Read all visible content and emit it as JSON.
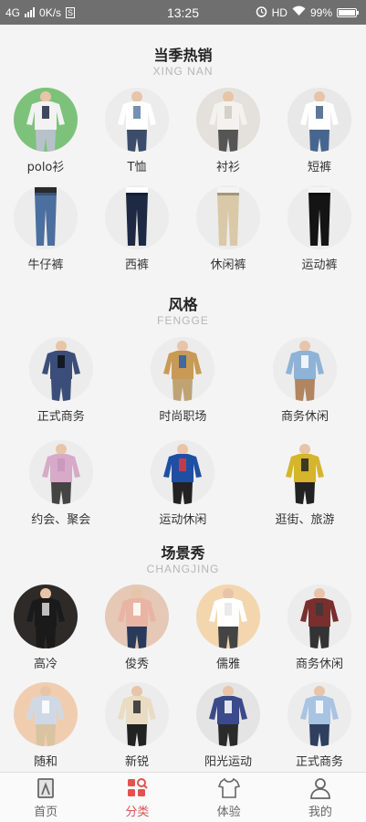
{
  "status_bar": {
    "network": "4G",
    "speed": "0K/s",
    "sim_badge": "S",
    "time": "13:25",
    "hd": "HD",
    "battery": "99%",
    "battery_level": 0.99
  },
  "sections": [
    {
      "title": "当季热销",
      "subtitle": "XING NAN",
      "items": [
        {
          "label": "polo衫",
          "icon": "polo-shirt",
          "bg": "#7dc27a",
          "top": "#f2f2f2",
          "accent": "#1f2a44",
          "bottom": "#b7c1cc"
        },
        {
          "label": "T恤",
          "icon": "t-shirt",
          "bg": "#ececec",
          "top": "#ffffff",
          "accent": "#5a7fa5",
          "bottom": "#3b4d6a"
        },
        {
          "label": "衬衫",
          "icon": "shirt",
          "bg": "#e4e1dc",
          "top": "#f4f2ee",
          "accent": "#cfcac3",
          "bottom": "#555555"
        },
        {
          "label": "短裤",
          "icon": "shorts",
          "bg": "#e8e8e8",
          "top": "#ffffff",
          "accent": "#3e5f8a",
          "bottom": "#46668f"
        },
        {
          "label": "牛仔裤",
          "icon": "jeans",
          "bg": "#ececec",
          "top": "#2a2a2a",
          "accent": "#4b6f9f",
          "bottom": "#4b6f9f"
        },
        {
          "label": "西裤",
          "icon": "trousers",
          "bg": "#ececec",
          "top": "#ffffff",
          "accent": "#1e2a44",
          "bottom": "#1e2a44"
        },
        {
          "label": "休闲裤",
          "icon": "chinos",
          "bg": "#ececec",
          "top": "#f4f4f4",
          "accent": "#d9c9a8",
          "bottom": "#d9c9a8"
        },
        {
          "label": "运动裤",
          "icon": "joggers",
          "bg": "#ececec",
          "top": "#f4f4f4",
          "accent": "#141414",
          "bottom": "#141414"
        }
      ]
    },
    {
      "title": "风格",
      "subtitle": "FENGGE",
      "items": [
        {
          "label": "正式商务",
          "icon": "suit",
          "bg": "#ececec",
          "top": "#3b4e7a",
          "accent": "#111111",
          "bottom": "#3b4e7a"
        },
        {
          "label": "时尚职场",
          "icon": "jacket",
          "bg": "#ececec",
          "top": "#c89a55",
          "accent": "#2b5fa8",
          "bottom": "#bfa374"
        },
        {
          "label": "商务休闲",
          "icon": "striped-shirt",
          "bg": "#ececec",
          "top": "#8fb3d6",
          "accent": "#ffffff",
          "bottom": "#b08560"
        },
        {
          "label": "约会、聚会",
          "icon": "sweater",
          "bg": "#ececec",
          "top": "#d6aac8",
          "accent": "#c896b8",
          "bottom": "#444444"
        },
        {
          "label": "运动休闲",
          "icon": "hoodie",
          "bg": "#ececec",
          "top": "#1f4fa3",
          "accent": "#d93b3b",
          "bottom": "#222222"
        },
        {
          "label": "逛街、旅游",
          "icon": "plaid-shirt",
          "bg": "#f4f4f4",
          "top": "#d4b52c",
          "accent": "#222222",
          "bottom": "#222222"
        }
      ]
    },
    {
      "title": "场景秀",
      "subtitle": "CHANGJING",
      "items": [
        {
          "label": "高冷",
          "icon": "print-sweater",
          "bg": "#2e2a27",
          "top": "#1a1a1a",
          "accent": "#dddddd",
          "bottom": "#1a1a1a"
        },
        {
          "label": "俊秀",
          "icon": "graphic-tee",
          "bg": "#e5c8b6",
          "top": "#e9b4a3",
          "accent": "#ffffff",
          "bottom": "#2a3a5a"
        },
        {
          "label": "儒雅",
          "icon": "white-shirt",
          "bg": "#f3d6ae",
          "top": "#ffffff",
          "accent": "#e6e6e6",
          "bottom": "#444444"
        },
        {
          "label": "商务休闲",
          "icon": "knit-top",
          "bg": "#ececec",
          "top": "#7a2f2f",
          "accent": "#3a3a3a",
          "bottom": "#333333"
        },
        {
          "label": "随和",
          "icon": "casual-shirt",
          "bg": "#f1cdb0",
          "top": "#cfd9e6",
          "accent": "#ffffff",
          "bottom": "#d8c4a0"
        },
        {
          "label": "新锐",
          "icon": "pattern-shirt",
          "bg": "#ececec",
          "top": "#e9dcc2",
          "accent": "#2b2b2b",
          "bottom": "#222222"
        },
        {
          "label": "阳光运动",
          "icon": "striped-sweater",
          "bg": "#e4e4e4",
          "top": "#3a4a8a",
          "accent": "#ffffff",
          "bottom": "#2a2a2a"
        },
        {
          "label": "正式商务",
          "icon": "dress-shirt",
          "bg": "#ececec",
          "top": "#a9c4e3",
          "accent": "#ffffff",
          "bottom": "#2f3f60"
        }
      ]
    }
  ],
  "bottom_nav": [
    {
      "label": "首页",
      "icon": "home-icon",
      "active": false
    },
    {
      "label": "分类",
      "icon": "category-icon",
      "active": true
    },
    {
      "label": "体验",
      "icon": "tshirt-icon",
      "active": false
    },
    {
      "label": "我的",
      "icon": "profile-icon",
      "active": false
    }
  ],
  "colors": {
    "active": "#e2524f",
    "inactive": "#666666",
    "status_bar": "#6f6f6f",
    "background": "#f4f4f4"
  }
}
